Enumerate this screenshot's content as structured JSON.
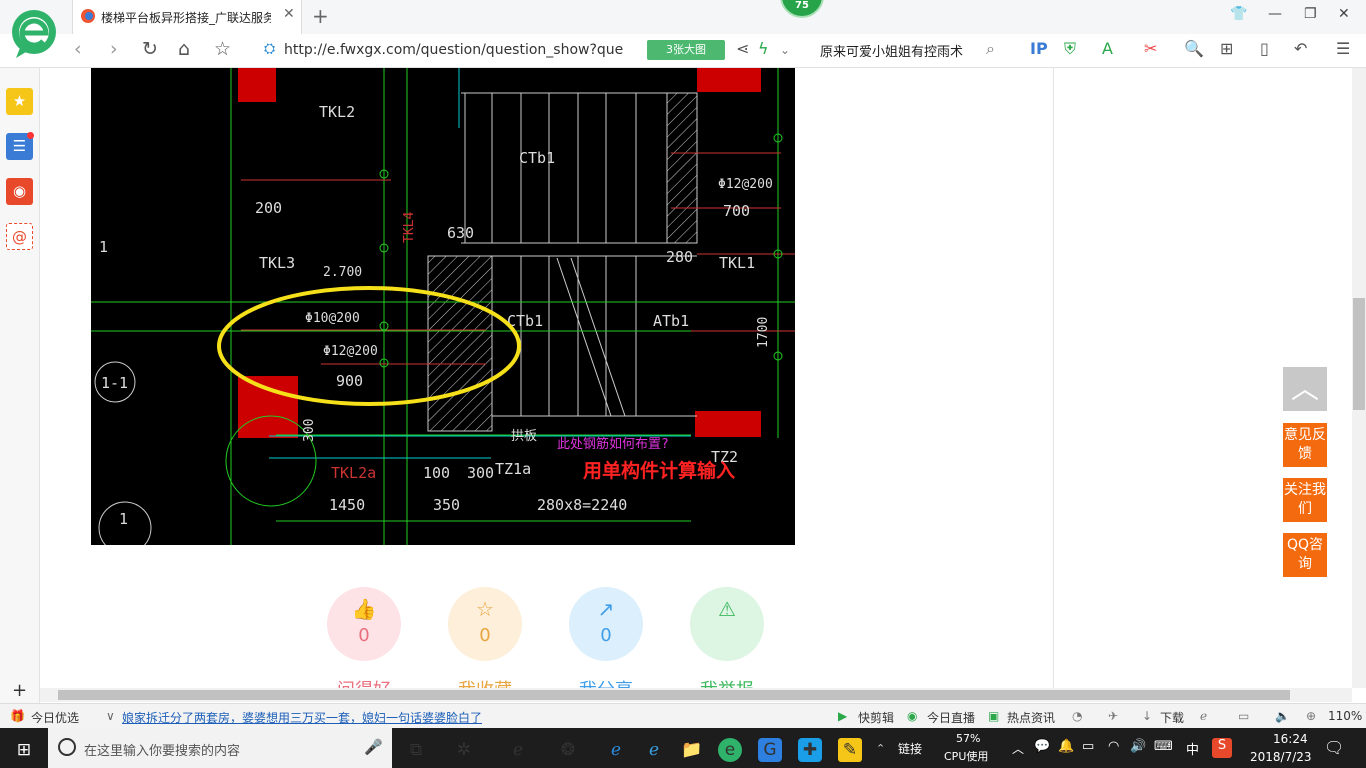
{
  "browser": {
    "tab_title": "楼梯平台板异形搭接_广联达服务",
    "tab_close": "✕",
    "new_tab": "+",
    "score": "75",
    "url": "http://e.fwxgx.com/question/question_show?que",
    "big_image_btn": "3张大图",
    "search_text": "原来可爱小姐姐有控雨术"
  },
  "cad": {
    "labels": [
      "TKL2",
      "CTb1",
      "Φ12@200",
      "700",
      "200",
      "TKL4",
      "630",
      "280",
      "TKL1",
      "TKL3",
      "2.700",
      "Φ10@200",
      "CTb1",
      "ATb1",
      "1700",
      "Φ12@200",
      "900",
      "1-1",
      "拱板",
      "此处钢筋如何布置?",
      "TZ2",
      "300",
      "TKL2a",
      "100",
      "300",
      "TZ1a",
      "1450",
      "350",
      "280x8=2240",
      "1",
      "1"
    ],
    "annotation": "用单构件计算输入",
    "question": "此处钢筋如何布置?"
  },
  "actions": [
    {
      "label": "问得好",
      "count": "0",
      "icon": "thumb-up-icon",
      "bg": "#fde3e6",
      "fg": "#e8707e"
    },
    {
      "label": "我收藏",
      "count": "0",
      "icon": "star-icon",
      "bg": "#fdefd9",
      "fg": "#e8a540"
    },
    {
      "label": "我分享",
      "count": "0",
      "icon": "share-icon",
      "bg": "#dbeffd",
      "fg": "#3f9ee8"
    },
    {
      "label": "我举报",
      "count": "",
      "icon": "warning-icon",
      "bg": "#ddf5e3",
      "fg": "#3fb960"
    }
  ],
  "side_float": {
    "feedback": "意见反馈",
    "follow": "关注我们",
    "qq": "QQ咨询"
  },
  "status_bar": {
    "today_pick": "今日优选",
    "news": "娘家拆迁分了两套房，婆婆想用三万买一套，媳妇一句话婆婆脸白了",
    "quick_cut": "快剪辑",
    "live": "今日直播",
    "hot_news": "热点资讯",
    "download": "下载",
    "zoom": "110%"
  },
  "taskbar": {
    "search_placeholder": "在这里输入你要搜索的内容",
    "link": "链接",
    "cpu_pct": "57%",
    "cpu_label": "CPU使用",
    "ime": "中",
    "time": "16:24",
    "date": "2018/7/23"
  }
}
